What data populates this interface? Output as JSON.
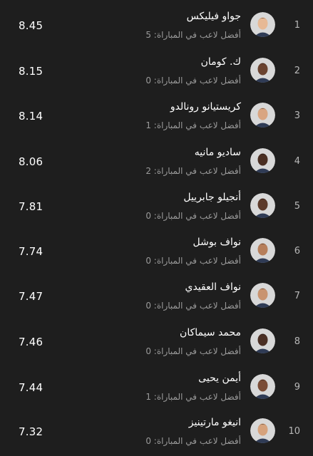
{
  "players": [
    {
      "rank": "1",
      "name": "جواو فيليكس",
      "subtitle": "أفضل لاعب في المباراة: 5",
      "rating": "8.45",
      "skin": "#e7b995",
      "hair": "#3b2a1e"
    },
    {
      "rank": "2",
      "name": "ك. كومان",
      "subtitle": "أفضل لاعب في المباراة: 0",
      "rating": "8.15",
      "skin": "#6b4330",
      "hair": "#1b1410"
    },
    {
      "rank": "3",
      "name": "كريستيانو رونالدو",
      "subtitle": "أفضل لاعب في المباراة: 1",
      "rating": "8.14",
      "skin": "#d9a581",
      "hair": "#2a1f18"
    },
    {
      "rank": "4",
      "name": "ساديو مانيه",
      "subtitle": "أفضل لاعب في المباراة: 2",
      "rating": "8.06",
      "skin": "#4a2e22",
      "hair": "#141010"
    },
    {
      "rank": "5",
      "name": "أنجيلو جابرييل",
      "subtitle": "أفضل لاعب في المباراة: 0",
      "rating": "7.81",
      "skin": "#5c3a2a",
      "hair": "#161111"
    },
    {
      "rank": "6",
      "name": "نواف بوشل",
      "subtitle": "أفضل لاعب في المباراة: 0",
      "rating": "7.74",
      "skin": "#b67e5a",
      "hair": "#1e1612"
    },
    {
      "rank": "7",
      "name": "نواف العقيدي",
      "subtitle": "أفضل لاعب في المباراة: 0",
      "rating": "7.47",
      "skin": "#c99470",
      "hair": "#231a14"
    },
    {
      "rank": "8",
      "name": "محمد سيماكان",
      "subtitle": "أفضل لاعب في المباراة: 0",
      "rating": "7.46",
      "skin": "#4b2f24",
      "hair": "#151010"
    },
    {
      "rank": "9",
      "name": "أيمن يحيى",
      "subtitle": "أفضل لاعب في المباراة: 1",
      "rating": "7.44",
      "skin": "#7a4c36",
      "hair": "#1a1311"
    },
    {
      "rank": "10",
      "name": "انيغو مارتينيز",
      "subtitle": "أفضل لاعب في المباراة: 0",
      "rating": "7.32",
      "skin": "#d6a27c",
      "hair": "#2b1f17"
    }
  ]
}
